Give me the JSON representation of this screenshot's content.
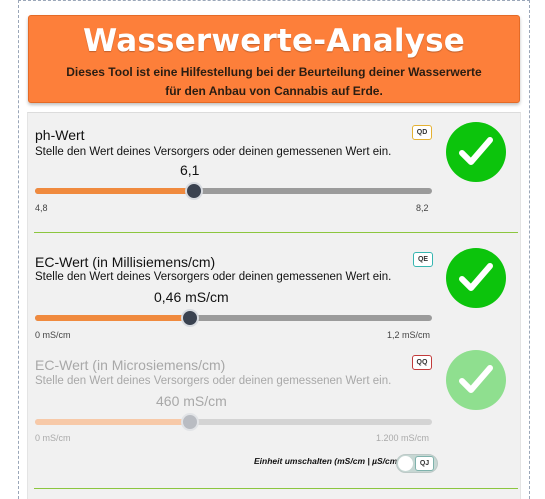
{
  "header": {
    "title": "Wasserwerte-Analyse",
    "subtitle_line1": "Dieses Tool ist eine Hilfestellung bei der Beurteilung deiner Wasserwerte",
    "subtitle_line2": "für den Anbau von Cannabis auf Erde."
  },
  "sections": {
    "ph": {
      "title": "ph-Wert",
      "description": "Stelle den Wert deines Versorgers oder deinen gemessenen Wert ein.",
      "tag": "QD",
      "tag_color": "#e5b132",
      "value_text": "6,1",
      "min_label": "4,8",
      "max_label": "8,2",
      "fraction": 0.4,
      "status": "check-icon"
    },
    "ec_ms": {
      "title": "EC-Wert (in Millisiemens/cm)",
      "description": "Stelle den Wert deines Versorgers oder deinen gemessenen Wert ein.",
      "tag": "QE",
      "tag_color": "#36b6b1",
      "value_text": "0,46 mS/cm",
      "min_label": "0 mS/cm",
      "max_label": "1,2 mS/cm",
      "fraction": 0.39,
      "status": "check-icon"
    },
    "ec_us": {
      "title": "EC-Wert (in Microsiemens/cm)",
      "description": "Stelle den Wert deines Versorgers oder deinen gemessenen Wert ein.",
      "tag": "QQ",
      "tag_color": "#c23a3a",
      "value_text": "460 mS/cm",
      "min_label": "0 mS/cm",
      "max_label": "1.200 mS/cm",
      "fraction": 0.39,
      "status": "check-icon"
    }
  },
  "unit_switch": {
    "label": "Einheit umschalten (mS/cm | µS/cm)",
    "tag": "QJ"
  },
  "colors": {
    "accent": "#fd7f3a",
    "success": "#0cc40c",
    "separator": "#8cc63f"
  }
}
